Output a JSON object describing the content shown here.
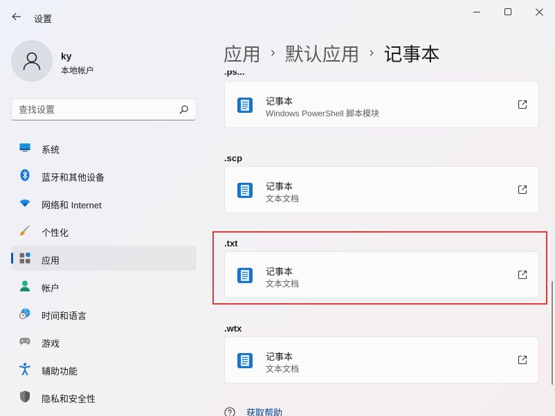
{
  "window": {
    "title": "设置",
    "controls": [
      "minimize-icon",
      "maximize-icon",
      "close-icon"
    ]
  },
  "profile": {
    "name": "ky",
    "account_type": "本地帐户"
  },
  "search": {
    "placeholder": "查找设置"
  },
  "sidebar": {
    "items": [
      {
        "label": "系统",
        "icon": "monitor-icon",
        "selected": false
      },
      {
        "label": "蓝牙和其他设备",
        "icon": "bluetooth-icon",
        "selected": false
      },
      {
        "label": "网络和 Internet",
        "icon": "wifi-icon",
        "selected": false
      },
      {
        "label": "个性化",
        "icon": "brush-icon",
        "selected": false
      },
      {
        "label": "应用",
        "icon": "apps-icon",
        "selected": true
      },
      {
        "label": "帐户",
        "icon": "person-icon",
        "selected": false
      },
      {
        "label": "时间和语言",
        "icon": "globe-clock-icon",
        "selected": false
      },
      {
        "label": "游戏",
        "icon": "gamepad-icon",
        "selected": false
      },
      {
        "label": "辅助功能",
        "icon": "accessibility-icon",
        "selected": false
      },
      {
        "label": "隐私和安全性",
        "icon": "shield-icon",
        "selected": false
      }
    ]
  },
  "breadcrumb": {
    "items": [
      "应用",
      "默认应用",
      "记事本"
    ],
    "separator": "›"
  },
  "associations": [
    {
      "extension": ".ps...",
      "app": "记事本",
      "description": "Windows PowerShell 脚本模块"
    },
    {
      "extension": ".scp",
      "app": "记事本",
      "description": "文本文档"
    },
    {
      "extension": ".txt",
      "app": "记事本",
      "description": "文本文档"
    },
    {
      "extension": ".wtx",
      "app": "记事本",
      "description": "文本文档"
    }
  ],
  "help": {
    "label": "获取帮助"
  },
  "colors": {
    "accent": "#005fb8",
    "highlight_box": "#e03a3a",
    "notepad_icon": "#1a74c9"
  }
}
